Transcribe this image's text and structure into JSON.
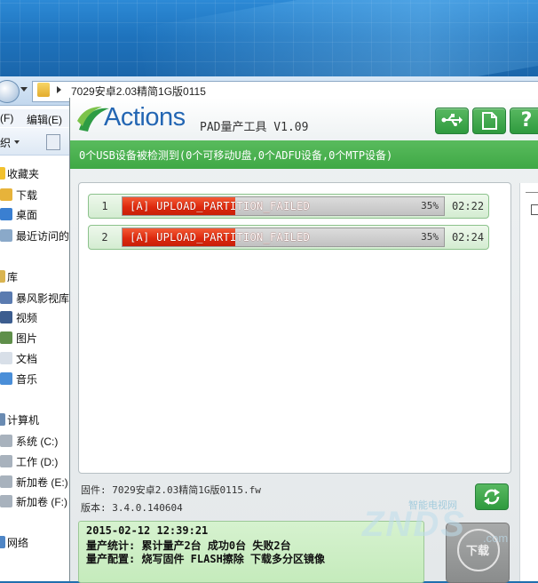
{
  "explorer": {
    "address_path": "7029安卓2.03精简1G版0115",
    "menu": {
      "file": "(F)",
      "edit": "编辑(E)"
    },
    "toolbar": {
      "organize": "织"
    },
    "sidebar": [
      {
        "label": "收藏夹",
        "icon": "star-icon",
        "header": true
      },
      {
        "label": "下载",
        "icon": "folder-icon"
      },
      {
        "label": "桌面",
        "icon": "desktop-icon"
      },
      {
        "label": "最近访问的",
        "icon": "recent-icon"
      },
      {
        "label": "库",
        "icon": "library-icon",
        "header": true
      },
      {
        "label": "暴风影视库",
        "icon": "video-lib-icon"
      },
      {
        "label": "视频",
        "icon": "video-icon"
      },
      {
        "label": "图片",
        "icon": "picture-icon"
      },
      {
        "label": "文档",
        "icon": "document-icon"
      },
      {
        "label": "音乐",
        "icon": "music-icon"
      },
      {
        "label": "计算机",
        "icon": "computer-icon",
        "header": true
      },
      {
        "label": "系统 (C:)",
        "icon": "drive-icon"
      },
      {
        "label": "工作 (D:)",
        "icon": "drive-icon"
      },
      {
        "label": "新加卷 (E:)",
        "icon": "drive-icon"
      },
      {
        "label": "新加卷 (F:)",
        "icon": "drive-icon"
      },
      {
        "label": "网络",
        "icon": "network-icon",
        "header": true
      }
    ]
  },
  "tool": {
    "logo_text": "Actions",
    "subtitle": "PAD量产工具 V1.09",
    "header_buttons": [
      "usb-icon",
      "document-icon",
      "help-icon"
    ],
    "help_label": "?",
    "status": "0个USB设备被检测到(0个可移动U盘,0个ADFU设备,0个MTP设备)",
    "devices": [
      {
        "index": "1",
        "message": "[A] UPLOAD_PARTITION_FAILED",
        "percent_text": "35%",
        "progress": 0.35,
        "time": "02:22"
      },
      {
        "index": "2",
        "message": "[A] UPLOAD_PARTITION_FAILED",
        "percent_text": "35%",
        "progress": 0.35,
        "time": "02:24"
      }
    ],
    "firmware": "固件: 7029安卓2.03精简1G版0115.fw",
    "version": "版本: 3.4.0.140604",
    "log": [
      "2015-02-12 12:39:21",
      "量产统计: 累计量产2台 成功0台 失败2台",
      "量产配置: 烧写固件 FLASH擦除 下载多分区镜像"
    ],
    "download_label": "下载",
    "accent_green": "#3fa845",
    "error_red": "#de2a0e"
  },
  "watermark": {
    "top": "智能电视网",
    "big": "ZNDS",
    "com": ".com"
  }
}
